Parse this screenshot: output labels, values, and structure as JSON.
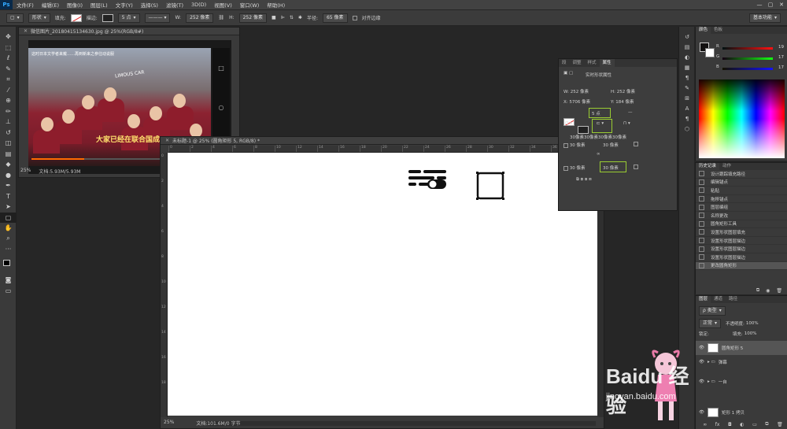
{
  "menubar": {
    "logo": "Ps",
    "items": [
      "文件(F)",
      "编辑(E)",
      "图像(I)",
      "图层(L)",
      "文字(Y)",
      "选择(S)",
      "滤镜(T)",
      "3D(D)",
      "视图(V)",
      "窗口(W)",
      "帮助(H)"
    ],
    "window_controls": [
      "—",
      "▢",
      "✕"
    ]
  },
  "options": {
    "mode": "形状",
    "fill_label": "填充:",
    "stroke_label": "描边:",
    "stroke_width": "5 点",
    "w_label": "W:",
    "w_value": "252 像素",
    "h_label": "H:",
    "h_value": "252 像素",
    "radius_label": "半径:",
    "radius_value": "65 像素",
    "align_edges": "对齐边缘",
    "workspace": "基本功能"
  },
  "toolbar": {
    "tools": [
      "move-tool",
      "marquee-tool",
      "lasso-tool",
      "quick-select-tool",
      "crop-tool",
      "eyedropper-tool",
      "healing-tool",
      "brush-tool",
      "stamp-tool",
      "history-brush-tool",
      "eraser-tool",
      "gradient-tool",
      "blur-tool",
      "dodge-tool",
      "pen-tool",
      "type-tool",
      "path-select-tool",
      "rounded-rect-tool",
      "hand-tool",
      "zoom-tool"
    ]
  },
  "doc1": {
    "title": "微信图片_20180415134630.jpg @ 25%(RGB/8#)",
    "overlay_text": "这时日本文学者来戴……再到新来之参往动说服",
    "subtitle": "大家已经在联合国成",
    "bus_sign": "LIMOUS CAR",
    "zoom": "25%",
    "doc_size": "文档:5.93M/5.93M"
  },
  "doc2": {
    "title": "未标题-1 @ 25% (圆角矩形 5, RGB/8) *",
    "ruler_h": [
      "0",
      "2",
      "4",
      "6",
      "8",
      "10",
      "12",
      "14",
      "16",
      "18",
      "20",
      "22",
      "24",
      "26",
      "28",
      "30",
      "32",
      "34",
      "36",
      "38"
    ],
    "ruler_v": [
      "0",
      "2",
      "4",
      "6",
      "8",
      "10",
      "12",
      "14",
      "16",
      "18"
    ],
    "zoom": "25%",
    "doc_size": "文档:101.6M/0 字节"
  },
  "properties": {
    "tabs": [
      "段",
      "调整",
      "样式",
      "属性"
    ],
    "active_tab": "属性",
    "header": "实时形状属性",
    "w_label": "W:",
    "w_value": "252 像素",
    "h_label": "H:",
    "h_value": "252 像素",
    "x_label": "X:",
    "x_value": "5706 像素",
    "y_label": "Y:",
    "y_value": "184 像素",
    "stroke_value": "5 点",
    "corners_text": "30像素30像素30像素30像素",
    "corner_tl": "30 像素",
    "corner_tr": "30 像素",
    "corner_bl": "30 像素",
    "corner_br": "30 像素",
    "stroke_dash": "—"
  },
  "color_panel": {
    "tabs": [
      "颜色",
      "色板"
    ],
    "r_value": "19",
    "g_value": "17",
    "b_value": "17",
    "r_label": "R",
    "g_label": "G",
    "b_label": "B"
  },
  "history": {
    "tabs": [
      "历史记录",
      "动作"
    ],
    "items": [
      "设计跟踪填充路径",
      "编辑锚点",
      "粘贴",
      "拖移锚点",
      "图层编组",
      "名称更改",
      "圆角矩形工具",
      "设置形状图层填充",
      "设置形状图层描边",
      "设置形状图层描边",
      "设置形状图层描边",
      "更改圆角矩形"
    ],
    "selected_index": 11
  },
  "layers": {
    "tabs": [
      "图层",
      "通道",
      "路径"
    ],
    "filter": "ρ 类型",
    "blend": "正常",
    "opacity_label": "不透明度:",
    "opacity_value": "100%",
    "lock_label": "锁定:",
    "fill_label": "填充:",
    "fill_value": "100%",
    "rows": [
      {
        "name": "圆角矩形 5",
        "type": "shape"
      },
      {
        "name": "弹幕",
        "type": "group"
      },
      {
        "name": "一自",
        "type": "group"
      },
      {
        "name": "矩形 1 拷贝",
        "type": "shape"
      }
    ]
  },
  "watermark": {
    "brand": "Baidu 经验",
    "url": "jingyan.baidu.com"
  },
  "colors": {
    "highlight": "#9acd32",
    "panel_bg": "#3a3a3a",
    "canvas_bg": "#ffffff"
  }
}
